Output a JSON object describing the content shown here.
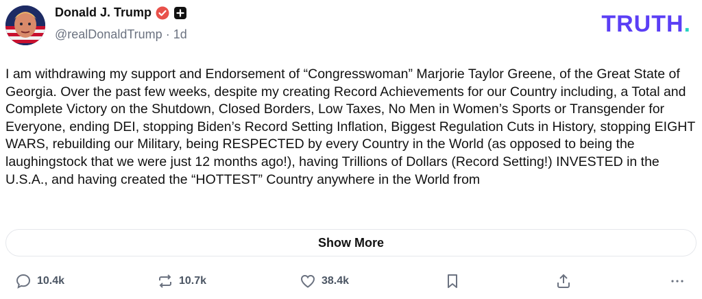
{
  "header": {
    "display_name": "Donald J. Trump",
    "handle": "@realDonaldTrump",
    "separator": "·",
    "time_ago": "1d",
    "brand_text": "TRUTH",
    "brand_dot": "."
  },
  "post": {
    "text": "I am withdrawing my support and Endorsement of “Congresswoman” Marjorie Taylor Greene, of the Great State of Georgia. Over the past few weeks, despite my creating Record Achievements for our Country including, a Total and Complete Victory on the Shutdown, Closed Borders, Low Taxes, No Men in Women’s Sports or Transgender for Everyone, ending DEI, stopping Biden’s Record Setting Inflation, Biggest Regulation Cuts in History, stopping EIGHT WARS, rebuilding our Military, being RESPECTED by every Country in the World (as opposed to being the laughingstock that we were just 12 months ago!), having Trillions of Dollars (Record Setting!) INVESTED in the U.S.A., and having created the “HOTTEST” Country anywhere in the World from"
  },
  "show_more_label": "Show More",
  "actions": {
    "replies": "10.4k",
    "reposts": "10.7k",
    "likes": "38.4k"
  },
  "colors": {
    "brand": "#5b3ff5",
    "brand_dot": "#27d2c1",
    "verified": "#e8504a"
  }
}
